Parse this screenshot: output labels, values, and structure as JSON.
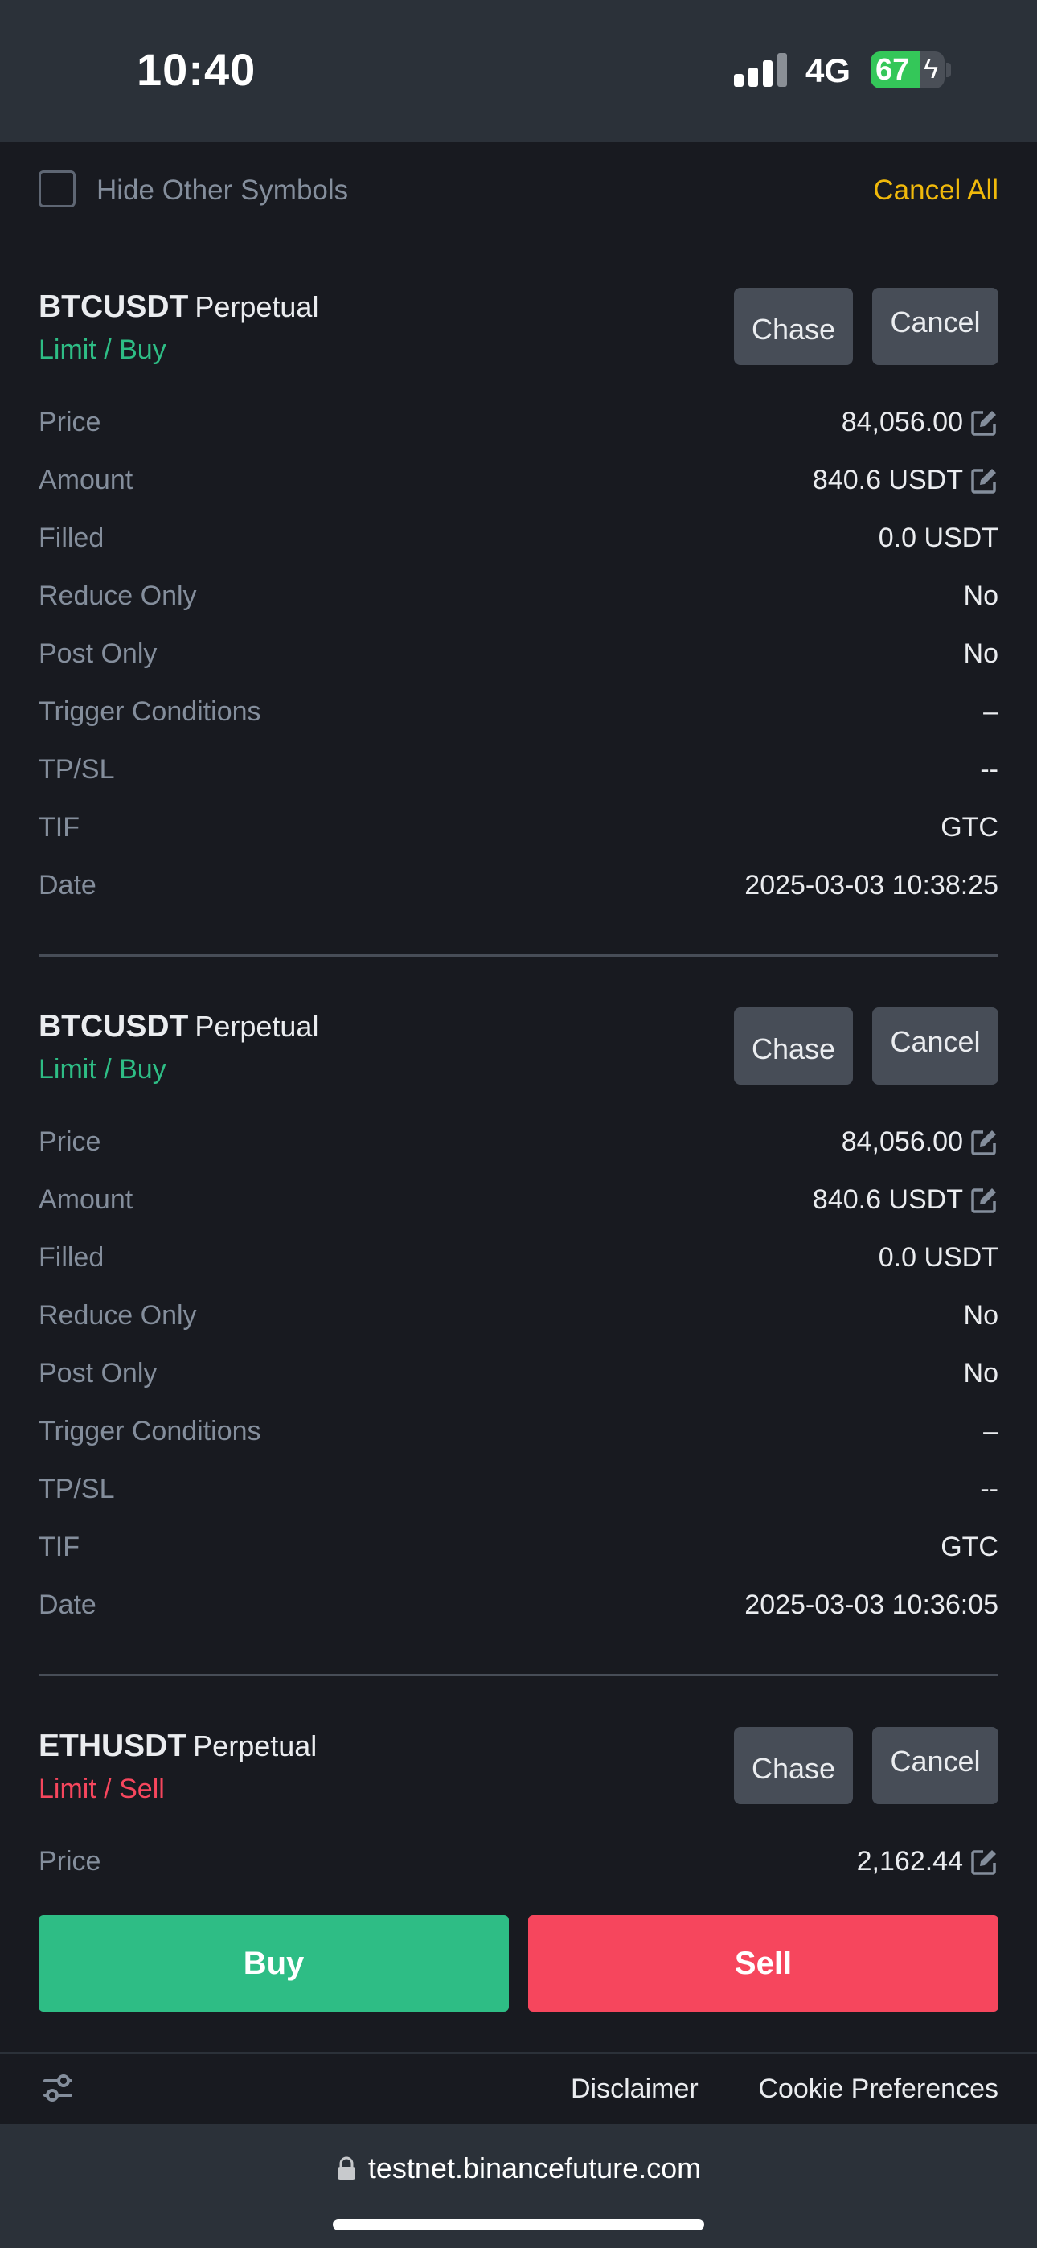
{
  "status_bar": {
    "time": "10:40",
    "network": "4G",
    "battery": "67",
    "battery_level": 0.67
  },
  "toolbar": {
    "hide_label": "Hide Other Symbols",
    "cancel_all": "Cancel All"
  },
  "orders": [
    {
      "symbol": "BTCUSDT",
      "product_type": "Perpetual",
      "side": "Limit / Buy",
      "chase_label": "Chase",
      "cancel_label": "Cancel",
      "rows": [
        {
          "label": "Price",
          "value": "84,056.00"
        },
        {
          "label": "Amount",
          "value": "840.6 USDT"
        },
        {
          "label": "Filled",
          "value": "0.0 USDT"
        },
        {
          "label": "Reduce Only",
          "value": "No"
        },
        {
          "label": "Post Only",
          "value": "No"
        },
        {
          "label": "Trigger Conditions",
          "value": "–"
        },
        {
          "label": "TP/SL",
          "value": "--"
        },
        {
          "label": "TIF",
          "value": "GTC"
        },
        {
          "label": "Date",
          "value": "2025-03-03 10:38:25"
        }
      ]
    },
    {
      "symbol": "BTCUSDT",
      "product_type": "Perpetual",
      "side": "Limit / Buy",
      "chase_label": "Chase",
      "cancel_label": "Cancel",
      "rows": [
        {
          "label": "Price",
          "value": "84,056.00"
        },
        {
          "label": "Amount",
          "value": "840.6 USDT"
        },
        {
          "label": "Filled",
          "value": "0.0 USDT"
        },
        {
          "label": "Reduce Only",
          "value": "No"
        },
        {
          "label": "Post Only",
          "value": "No"
        },
        {
          "label": "Trigger Conditions",
          "value": "–"
        },
        {
          "label": "TP/SL",
          "value": "--"
        },
        {
          "label": "TIF",
          "value": "GTC"
        },
        {
          "label": "Date",
          "value": "2025-03-03 10:36:05"
        }
      ]
    },
    {
      "symbol": "ETHUSDT",
      "product_type": "Perpetual",
      "side": "Limit / Sell",
      "chase_label": "Chase",
      "cancel_label": "Cancel",
      "rows": [
        {
          "label": "Price",
          "value": "2,162.44"
        }
      ]
    }
  ],
  "actions": {
    "buy": "Buy",
    "sell": "Sell"
  },
  "footer": {
    "disclaimer": "Disclaimer",
    "cookie": "Cookie Preferences"
  },
  "browser": {
    "url": "testnet.binancefuture.com"
  },
  "colors": {
    "buy": "#2ebd85",
    "sell": "#f6465d",
    "accent": "#f0b90b",
    "background": "#181a20"
  },
  "icons": {
    "edit": "edit-icon",
    "settings": "sliders-icon",
    "lock": "lock-icon"
  }
}
